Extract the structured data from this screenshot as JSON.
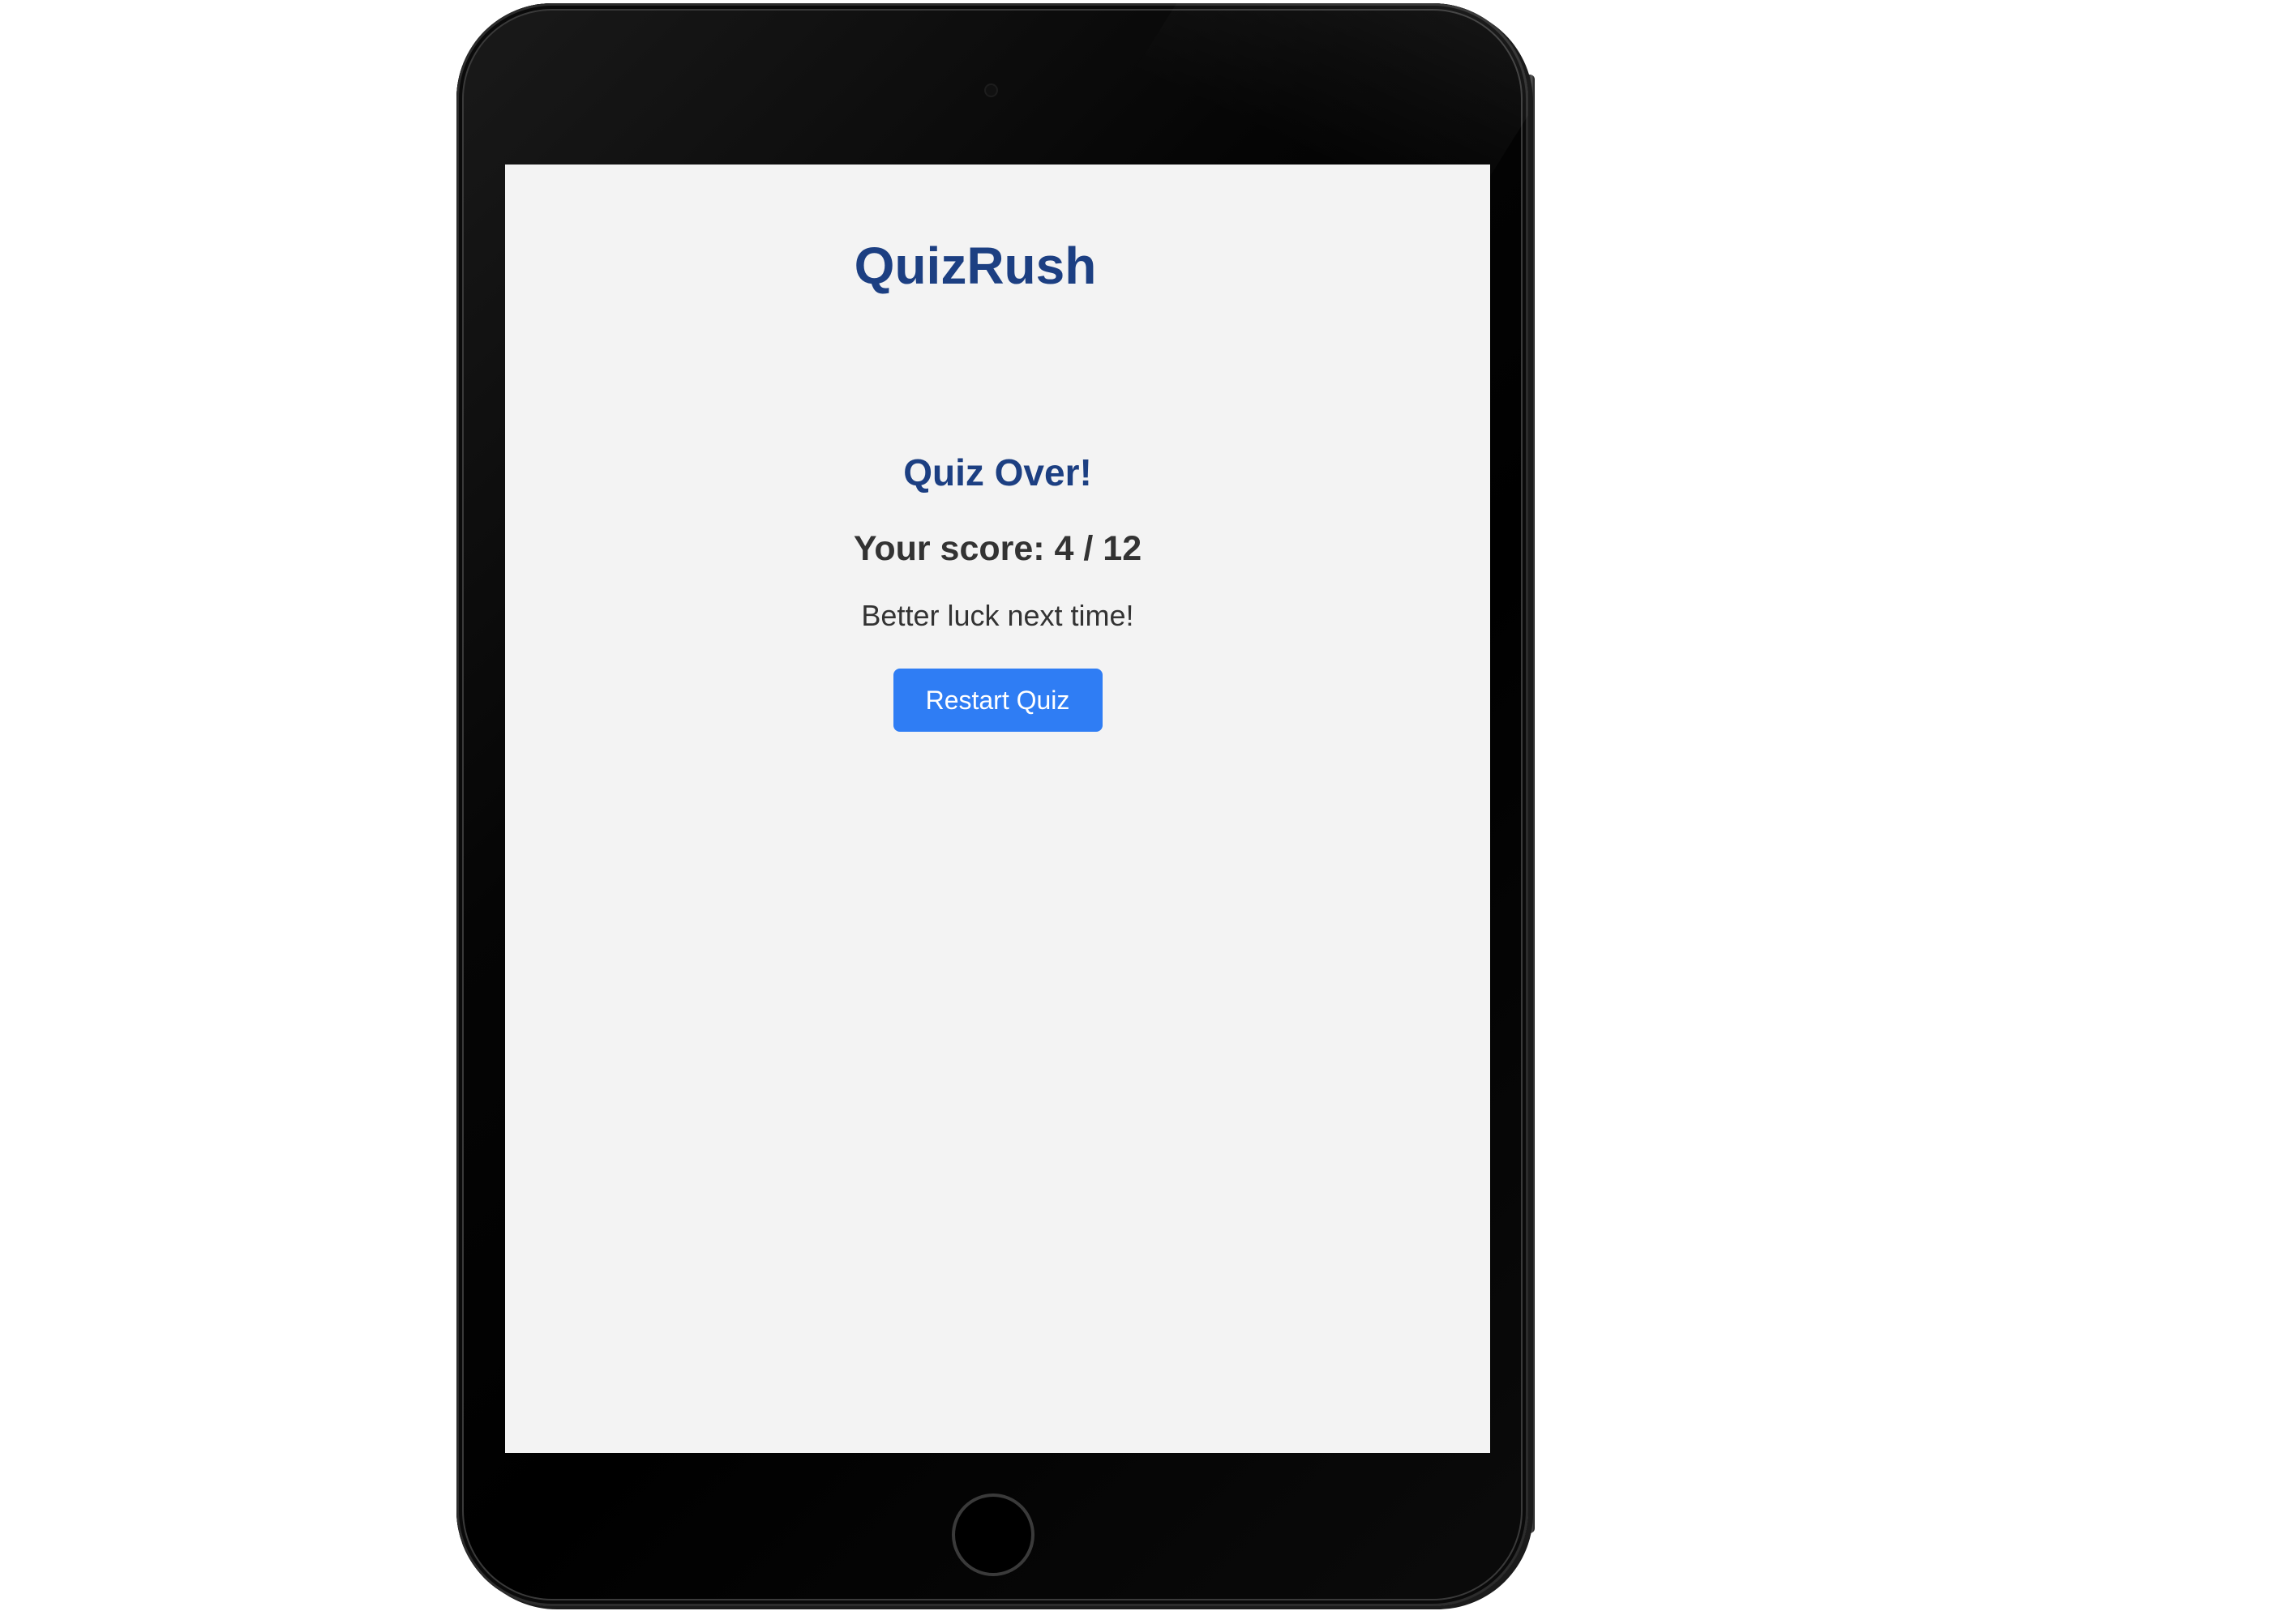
{
  "app": {
    "title": "QuizRush"
  },
  "results": {
    "heading": "Quiz Over!",
    "score_label": "Your score: 4 / 12",
    "score": 4,
    "total": 12,
    "message": "Better luck next time!",
    "restart_label": "Restart Quiz"
  },
  "colors": {
    "brand": "#1c3f82",
    "button": "#2f7df4",
    "screen_background": "#f3f3f3",
    "text": "#333333"
  },
  "icons": {
    "camera": "camera-icon",
    "home": "home-button-icon"
  }
}
